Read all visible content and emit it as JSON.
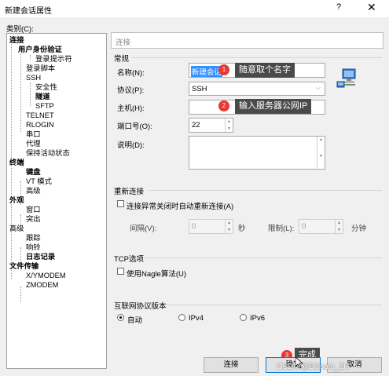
{
  "window": {
    "title": "新建会话属性",
    "help": "?",
    "close": "✕"
  },
  "category_label": "类别(C):",
  "tree": [
    {
      "label": "连接",
      "bold": true
    },
    {
      "label": "用户身份验证",
      "bold": true
    },
    {
      "label": "登录提示符",
      "bold": false
    },
    {
      "label": "登录脚本",
      "bold": false
    },
    {
      "label": "SSH",
      "bold": false
    },
    {
      "label": "安全性",
      "bold": false
    },
    {
      "label": "隧道",
      "bold": true
    },
    {
      "label": "SFTP",
      "bold": false
    },
    {
      "label": "TELNET",
      "bold": false
    },
    {
      "label": "RLOGIN",
      "bold": false
    },
    {
      "label": "串口",
      "bold": false
    },
    {
      "label": "代理",
      "bold": false
    },
    {
      "label": "保持活动状态",
      "bold": false
    },
    {
      "label": "终端",
      "bold": true
    },
    {
      "label": "键盘",
      "bold": true
    },
    {
      "label": "VT 模式",
      "bold": false
    },
    {
      "label": "高级",
      "bold": false
    },
    {
      "label": "外观",
      "bold": true
    },
    {
      "label": "窗口",
      "bold": false
    },
    {
      "label": "突出",
      "bold": false
    },
    {
      "label": "高级",
      "bold": false
    },
    {
      "label": "跟踪",
      "bold": false
    },
    {
      "label": "响铃",
      "bold": false
    },
    {
      "label": "日志记录",
      "bold": true
    },
    {
      "label": "文件传输",
      "bold": true
    },
    {
      "label": "X/YMODEM",
      "bold": false
    },
    {
      "label": "ZMODEM",
      "bold": false
    }
  ],
  "breadcrumb": "连接",
  "general": {
    "title": "常规",
    "name_label": "名称(N):",
    "name_value": "新建会话",
    "protocol_label": "协议(P):",
    "protocol_value": "SSH",
    "host_label": "主机(H):",
    "host_value": "",
    "port_label": "端口号(O):",
    "port_value": "22",
    "desc_label": "说明(D):",
    "desc_value": ""
  },
  "callouts": [
    {
      "num": "1",
      "text": "随意取个名字"
    },
    {
      "num": "2",
      "text": "输入服务器公网IP"
    },
    {
      "num": "3",
      "text": "完成"
    }
  ],
  "reconnect": {
    "title": "重新连接",
    "checkbox_label": "连接异常关闭时自动重新连接(A)",
    "interval_label": "间隔(V):",
    "interval_value": "0",
    "interval_unit": "秒",
    "limit_label": "限制(L):",
    "limit_value": "0",
    "limit_unit": "分钟"
  },
  "tcp": {
    "title": "TCP选项",
    "nagle_label": "使用Nagle算法(U)"
  },
  "ipver": {
    "title": "互联网协议版本",
    "options": [
      "自动",
      "IPv4",
      "IPv6"
    ],
    "selected": "自动"
  },
  "buttons": {
    "connect": "连接",
    "ok": "确定",
    "cancel": "取消"
  },
  "watermark": "CSDN @Bitisaia_ZH"
}
